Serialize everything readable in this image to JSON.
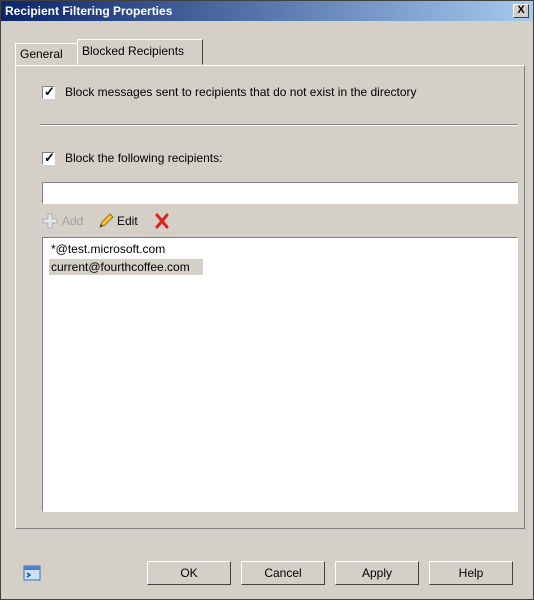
{
  "window": {
    "title": "Recipient Filtering Properties",
    "close_glyph": "X"
  },
  "tabs": [
    {
      "label": "General"
    },
    {
      "label": "Blocked Recipients"
    }
  ],
  "panel": {
    "block_nonexistent": {
      "checked": true,
      "label": "Block messages sent to recipients that do not exist in the directory"
    },
    "block_following": {
      "checked": true,
      "label": "Block the following recipients:"
    },
    "recipient_input": {
      "value": ""
    },
    "toolbar": {
      "add_label": "Add",
      "edit_label": "Edit"
    },
    "recipients": [
      {
        "address": "*@test.microsoft.com",
        "selected": false
      },
      {
        "address": "current@fourthcoffee.com",
        "selected": true
      }
    ]
  },
  "buttons": {
    "ok": "OK",
    "cancel": "Cancel",
    "apply": "Apply",
    "help": "Help"
  },
  "colors": {
    "title_start": "#0a246a",
    "title_end": "#a6caf0",
    "delete_icon": "#e02020"
  }
}
